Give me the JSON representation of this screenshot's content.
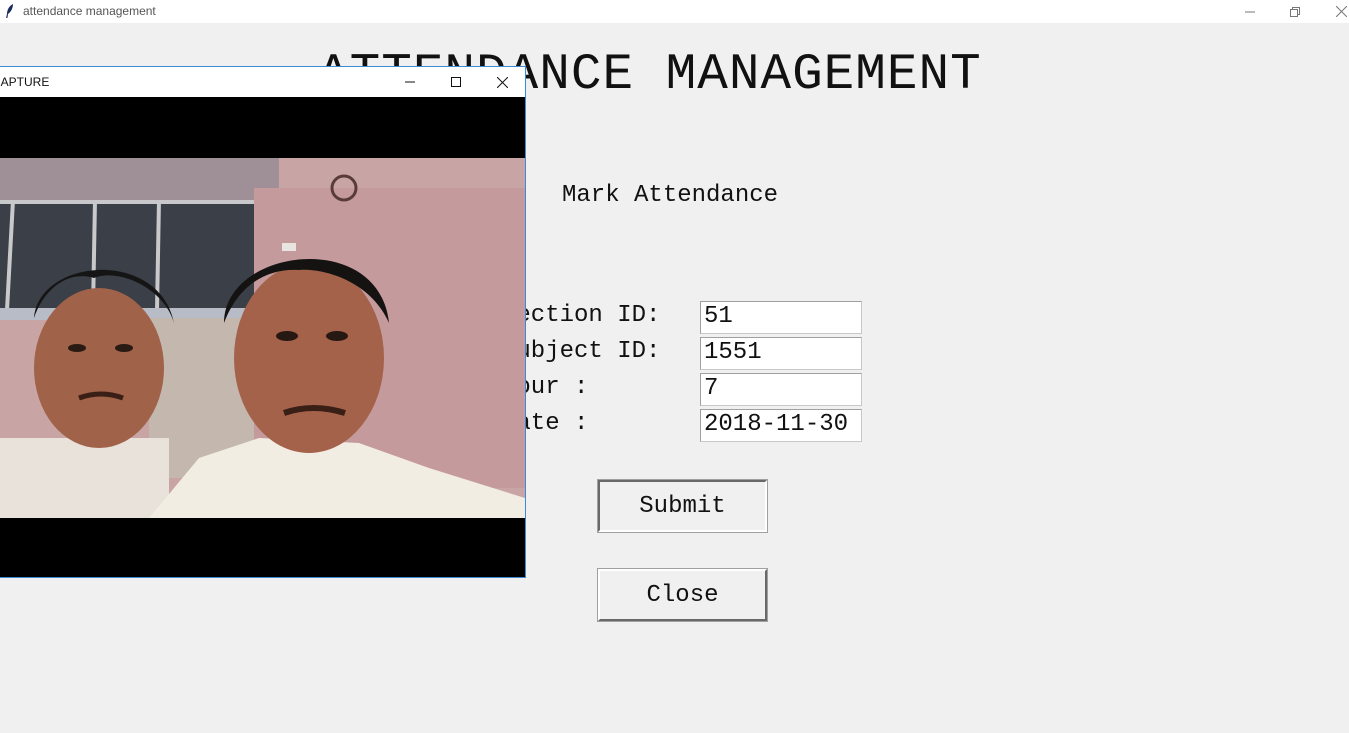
{
  "window": {
    "title": "attendance management",
    "icons": {
      "app": "feather-icon",
      "minimize": "minimize-icon",
      "restore": "restore-icon",
      "close": "close-icon"
    }
  },
  "main": {
    "heading": "ATTENDANCE MANAGEMENT",
    "subheading": "Mark Attendance",
    "fields": [
      {
        "label": "Section ID:",
        "value": "51"
      },
      {
        "label": "Subject ID:",
        "value": "1551"
      },
      {
        "label": "Hour :",
        "value": "7"
      },
      {
        "label": "Date :",
        "value": "2018-11-30"
      }
    ],
    "submit_label": "Submit",
    "close_label": "Close"
  },
  "capture_window": {
    "title": "CAPTURE",
    "icons": {
      "minimize": "minimize-icon",
      "maximize": "maximize-icon",
      "close": "close-icon"
    }
  },
  "colors": {
    "background": "#f0f0f0",
    "accent_border": "#3c8ad6"
  }
}
